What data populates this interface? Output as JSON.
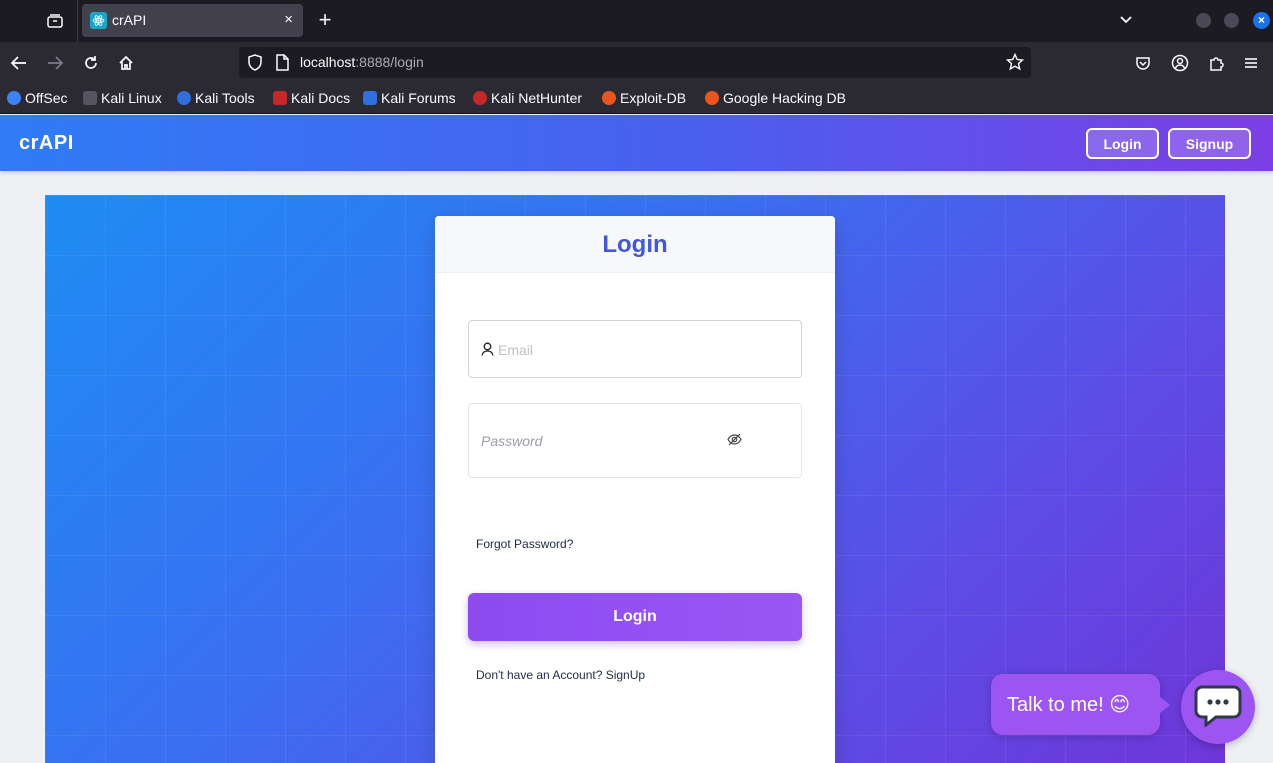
{
  "browser": {
    "tab": {
      "title": "crAPI",
      "close_label": "×"
    },
    "new_tab_label": "+",
    "url": {
      "host": "localhost",
      "rest": ":8888/login"
    },
    "bookmarks": [
      {
        "label": "OffSec",
        "color": "#3b82f6"
      },
      {
        "label": "Kali Linux",
        "color": "#2b2a33"
      },
      {
        "label": "Kali Tools",
        "color": "#2f6fde"
      },
      {
        "label": "Kali Docs",
        "color": "#c62828"
      },
      {
        "label": "Kali Forums",
        "color": "#2f6fde"
      },
      {
        "label": "Kali NetHunter",
        "color": "#c62828"
      },
      {
        "label": "Exploit-DB",
        "color": "#e8561d"
      },
      {
        "label": "Google Hacking DB",
        "color": "#e8561d"
      }
    ]
  },
  "app": {
    "brand": "crAPI",
    "header_buttons": {
      "login": "Login",
      "signup": "Signup"
    },
    "login_card": {
      "title": "Login",
      "email_placeholder": "Email",
      "password_placeholder": "Password",
      "forgot_password": "Forgot Password?",
      "submit_label": "Login",
      "signup_prompt": "Don't have an Account? SignUp"
    },
    "chat": {
      "bubble_text": "Talk to me! 😊"
    }
  },
  "colors": {
    "header_gradient": [
      "#2f7cf6",
      "#7d3ee6"
    ],
    "title_accent": "#4358d9",
    "button_purple": "#9a55f5"
  }
}
